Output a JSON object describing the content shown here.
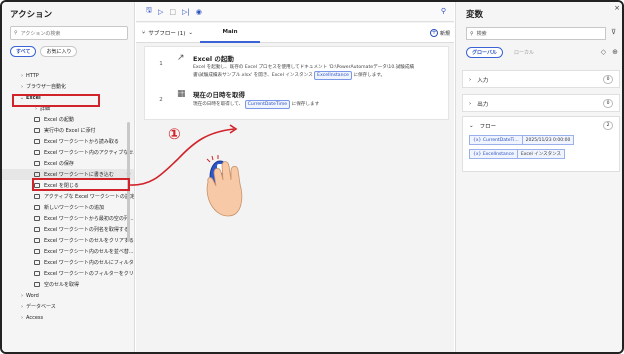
{
  "actions_panel": {
    "title": "アクション",
    "search_placeholder": "アクションの検索",
    "filters": [
      "すべて",
      "お気に入り"
    ],
    "tree": [
      {
        "label": "HTTP",
        "level": 1,
        "chevron": "›"
      },
      {
        "label": "ブラウザー自動化",
        "level": 1,
        "chevron": "›"
      },
      {
        "label": "Excel",
        "level": 1,
        "chevron": "⌄"
      },
      {
        "label": "詳細",
        "level": 2,
        "chevron": "›"
      },
      {
        "label": "Excel の起動",
        "level": 3
      },
      {
        "label": "実行中の Excel に添付",
        "level": 3
      },
      {
        "label": "Excel ワークシートから読み取る",
        "level": 3
      },
      {
        "label": "Excel ワークシート内のアクティブなセ...",
        "level": 3
      },
      {
        "label": "Excel の保存",
        "level": 3
      },
      {
        "label": "Excel ワークシートに書き込む",
        "level": 3
      },
      {
        "label": "Excel を閉じる",
        "level": 3
      },
      {
        "label": "アクティブな Excel ワークシートの設定",
        "level": 3
      },
      {
        "label": "新しいワークシートの追加",
        "level": 3
      },
      {
        "label": "Excel ワークシートから最初の空の列...",
        "level": 3
      },
      {
        "label": "Excel ワークシートの列名を取得する",
        "level": 3
      },
      {
        "label": "Excel ワークシートのセルをクリアする",
        "level": 3
      },
      {
        "label": "Excel ワークシート内のセルを並べ替...",
        "level": 3
      },
      {
        "label": "Excel ワークシート内のセルにフィルター...",
        "level": 3
      },
      {
        "label": "Excel ワークシートのフィルターをクリ...",
        "level": 3
      },
      {
        "label": "空のセルを取得",
        "level": 3
      },
      {
        "label": "Word",
        "level": 1,
        "chevron": "›"
      },
      {
        "label": "データベース",
        "level": 1,
        "chevron": "›"
      },
      {
        "label": "Access",
        "level": 1,
        "chevron": "›"
      }
    ]
  },
  "center": {
    "subflow_label": "サブフロー (1)",
    "tab_main": "Main",
    "new_label": "新規",
    "steps": [
      {
        "number": "1",
        "title": "Excel の起動",
        "desc_1": "Excel を起動し、既存の Excel プロセスを使用してドキュメント 'D:\\PowerAutomateデータ\\10.試験成績",
        "desc_2a": "書\\試験成績表サンプル.xlsx' を開き、Excel インスタンス",
        "desc_2_tag": "ExcelInstance",
        "desc_2b": "に保存します。"
      },
      {
        "number": "2",
        "title": "現在の日時を取得",
        "desc_a": "現在の日時を取得して、",
        "desc_tag": "CurrentDateTime",
        "desc_b": "に保存します"
      }
    ]
  },
  "annotation": {
    "number": "①"
  },
  "variables_panel": {
    "title": "変数",
    "search_placeholder": "検索",
    "tabs": [
      "グローバル",
      "ローカル"
    ],
    "sections": [
      {
        "label": "入力",
        "count": "0"
      },
      {
        "label": "出力",
        "count": "0"
      },
      {
        "label": "フロー",
        "count": "2"
      }
    ],
    "flow_vars": [
      {
        "name": "CurrentDateTi...",
        "value": "2025/11/23 0:00:00"
      },
      {
        "name": "ExcelInstance",
        "value": "Excel インスタンス"
      }
    ]
  },
  "colors": {
    "accent": "#3b63d6",
    "annotation_red": "#d1232a"
  }
}
